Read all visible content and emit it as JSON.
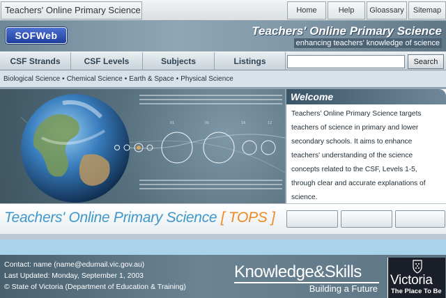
{
  "header": {
    "site_title": "Teachers' Online Primary Science",
    "links": [
      "Home",
      "Help",
      "Gloassary",
      "Sitemap"
    ]
  },
  "banner": {
    "logo": "SOFWeb",
    "title": "Teachers' Online Primary Science",
    "subtitle": "enhancing teachers' knowledge of science"
  },
  "nav": {
    "items": [
      "CSF Strands",
      "CSF Levels",
      "Subjects",
      "Listings"
    ],
    "search_value": "",
    "search_button": "Search"
  },
  "sublinks": [
    "Biological Science",
    "Chemical Science",
    "Earth & Space",
    "Physical Science"
  ],
  "welcome": {
    "heading": "Welcome",
    "text": "Teachers' Online Primary Science targets teachers of science in primary and lower secondary schools. It aims to enhance teachers' understanding of the science concepts related to the CSF, Levels 1-5, through clear and accurate explanations of science."
  },
  "tops": {
    "title": "Teachers' Online Primary Science",
    "abbr": "[ TOPS ]"
  },
  "footer": {
    "contact": "Contact: name (name@edumail.vic.gov.au)",
    "updated": "Last Updated: Monday, September 1, 2003",
    "copyright": "© State of Victoria (Department of Education & Training)",
    "ks_title": "Knowledge&Skills",
    "ks_sub": "Building a Future",
    "vic_name": "Victoria",
    "vic_tag": "The Place To Be"
  },
  "colors": {
    "accent_blue": "#3f98c8",
    "accent_orange": "#f08a24",
    "banner_dark": "#4b6275"
  }
}
